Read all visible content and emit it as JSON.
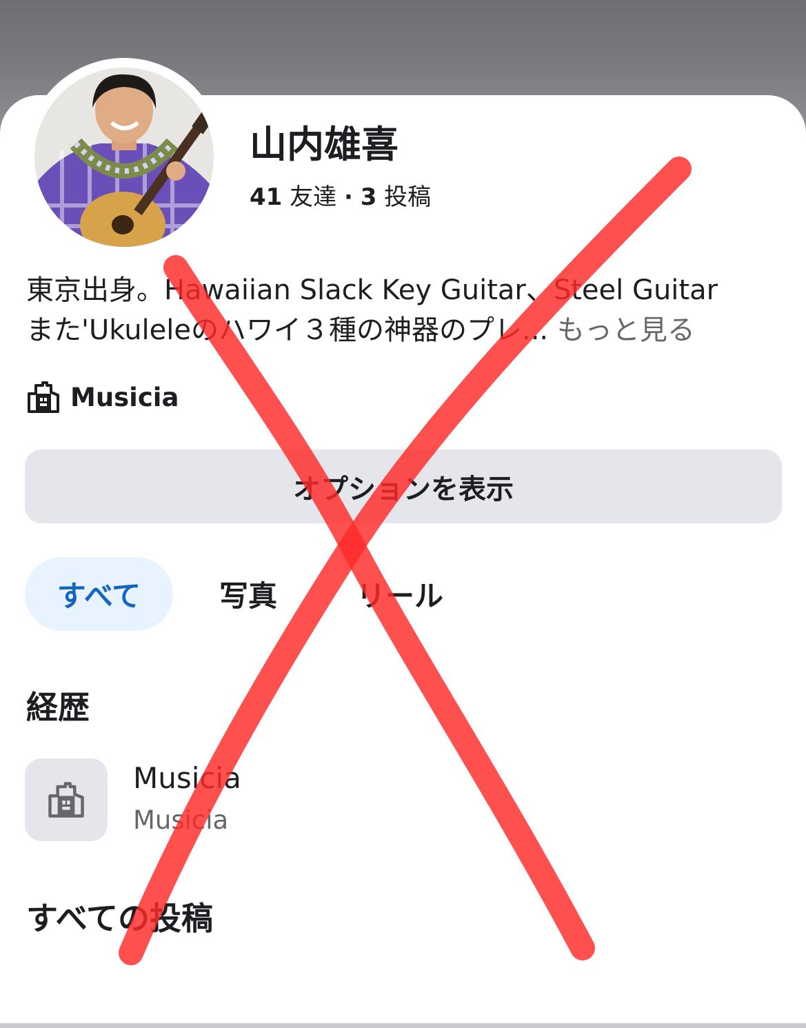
{
  "profile": {
    "name": "山内雄喜",
    "friends_count": "41",
    "friends_label": "友達",
    "separator": "·",
    "posts_count": "3",
    "posts_label": "投稿",
    "bio_line1": "東京出身。Hawaiian Slack Key Guitar、Steel Guitar",
    "bio_line2": "また'Ukuleleのハワイ３種の神器のプレ...",
    "see_more": "もっと見る",
    "workplace": "Musicia"
  },
  "actions": {
    "options_label": "オプションを表示"
  },
  "tabs": [
    {
      "label": "すべて",
      "active": true
    },
    {
      "label": "写真",
      "active": false
    },
    {
      "label": "リール",
      "active": false
    }
  ],
  "experience": {
    "section_title": "経歴",
    "items": [
      {
        "title": "Musicia",
        "subtitle": "Musicia",
        "icon": "building-icon"
      }
    ]
  },
  "posts": {
    "section_title": "すべての投稿"
  },
  "colors": {
    "accent": "#1565c0",
    "tab_active_bg": "#e7f3ff",
    "button_bg": "#e4e6eb",
    "overlay_x": "#ff2a2a"
  }
}
